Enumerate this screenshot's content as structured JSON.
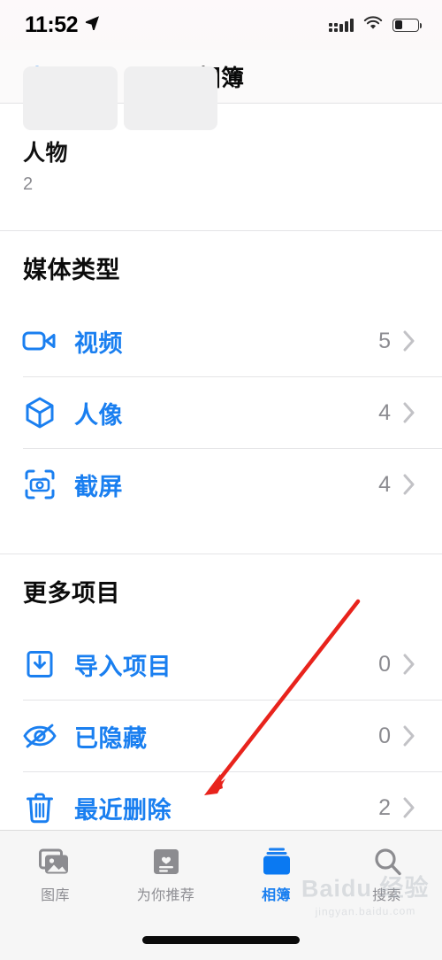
{
  "status_bar": {
    "time": "11:52",
    "location_icon": "location-arrow-icon",
    "signal_icon": "cellular-signal-icon",
    "wifi_icon": "wifi-icon",
    "battery_icon": "battery-icon",
    "battery_level_percent": 34
  },
  "nav": {
    "title": "相簿",
    "add_label": "+"
  },
  "people_section": {
    "title": "人物",
    "count": "2"
  },
  "media_types": {
    "header": "媒体类型",
    "rows": [
      {
        "icon": "video-icon",
        "label": "视频",
        "count": "5"
      },
      {
        "icon": "cube-icon",
        "label": "人像",
        "count": "4"
      },
      {
        "icon": "screenshot-icon",
        "label": "截屏",
        "count": "4"
      }
    ]
  },
  "more_items": {
    "header": "更多项目",
    "rows": [
      {
        "icon": "import-tray-icon",
        "label": "导入项目",
        "count": "0"
      },
      {
        "icon": "eye-slash-icon",
        "label": "已隐藏",
        "count": "0"
      },
      {
        "icon": "trash-icon",
        "label": "最近删除",
        "count": "2"
      }
    ]
  },
  "tab_bar": {
    "tabs": [
      {
        "icon": "photos-library-icon",
        "label": "图库",
        "active": false
      },
      {
        "icon": "for-you-card-icon",
        "label": "为你推荐",
        "active": false
      },
      {
        "icon": "albums-stack-icon",
        "label": "相簿",
        "active": true
      },
      {
        "icon": "search-magnifier-icon",
        "label": "搜索",
        "active": false
      }
    ]
  },
  "annotation": {
    "type": "arrow",
    "color": "#e8231c",
    "points_at": "最近删除"
  },
  "watermark": {
    "main": "Baidu 经验",
    "sub": "jingyan.baidu.com"
  },
  "colors": {
    "accent_blue": "#1a7ff0",
    "count_gray": "#8b8b90",
    "chevron_gray": "#c2c2c6",
    "separator": "#e4e4e6",
    "tabbar_bg": "#f6f6f6"
  }
}
